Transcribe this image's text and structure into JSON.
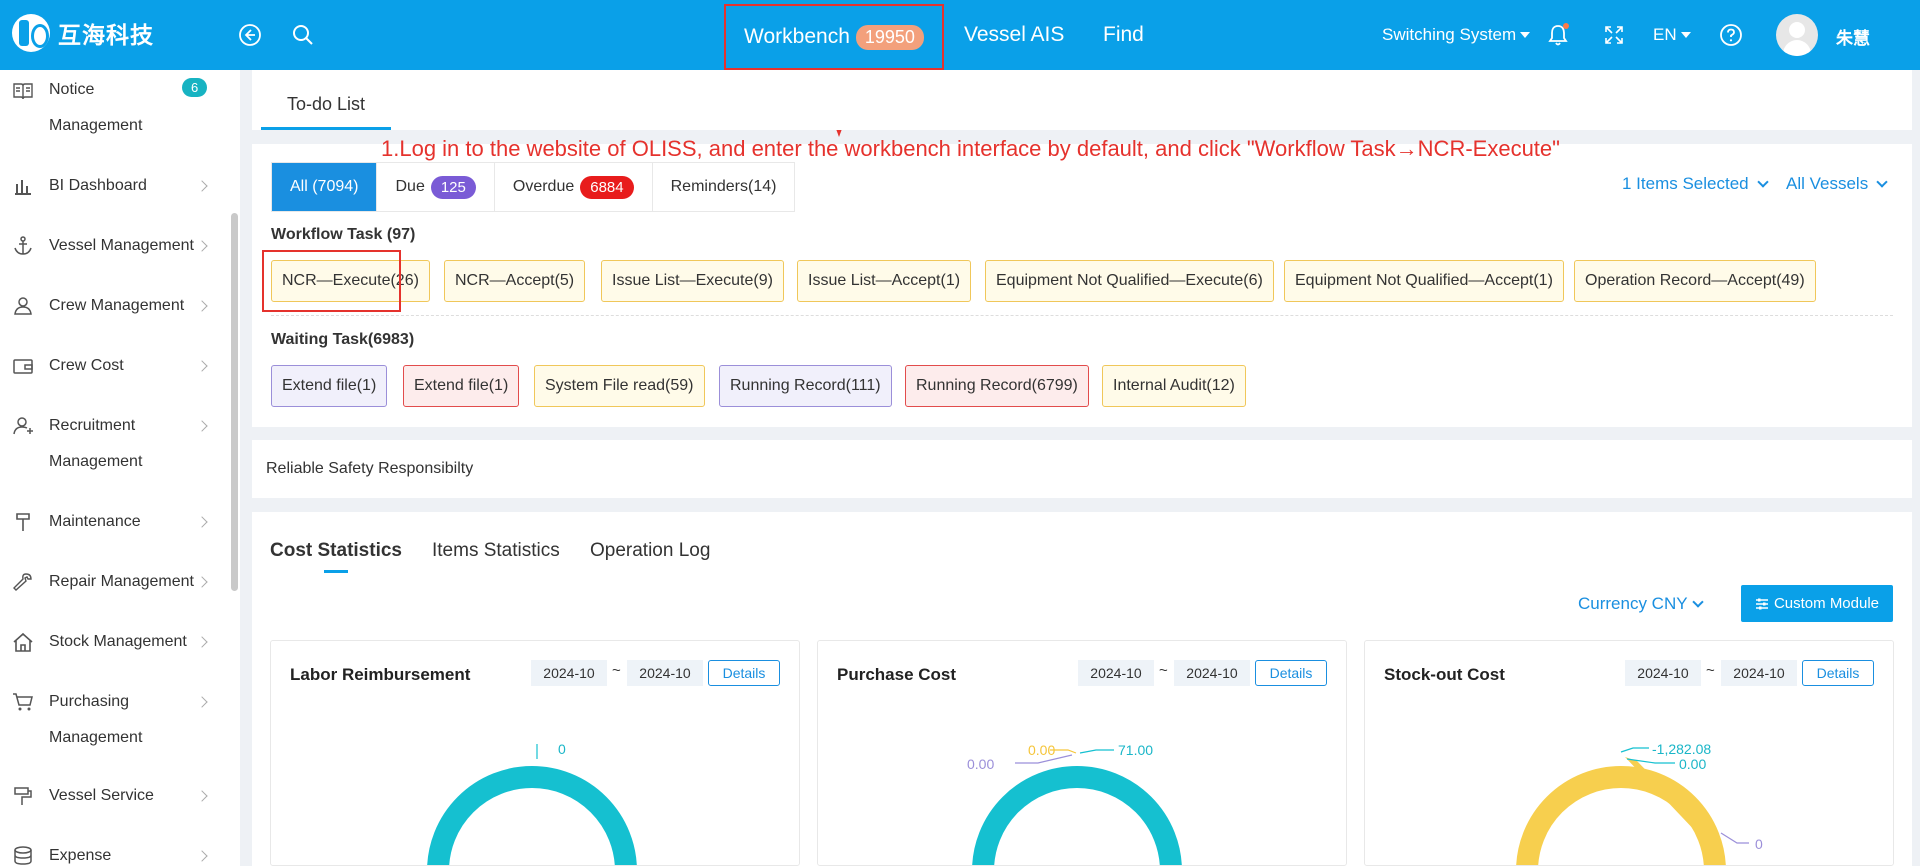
{
  "header": {
    "logo_text": "互海科技",
    "nav": {
      "workbench_label": "Workbench",
      "workbench_count": "19950",
      "vessel_ais": "Vessel AIS",
      "find": "Find"
    },
    "switching_system": "Switching System",
    "language": "EN",
    "user_name": "朱慧",
    "colors": {
      "bar": "#0aa0e8",
      "highlight": "#e5322d"
    }
  },
  "sidebar": {
    "items": [
      {
        "label": "Notice",
        "label2": "Management",
        "badge": "6",
        "icon": "book-icon"
      },
      {
        "label": "BI Dashboard",
        "icon": "bar-chart-icon"
      },
      {
        "label": "Vessel Management",
        "icon": "anchor-icon"
      },
      {
        "label": "Crew Management",
        "icon": "user-icon"
      },
      {
        "label": "Crew Cost",
        "icon": "wallet-icon"
      },
      {
        "label": "Recruitment",
        "label2": "Management",
        "icon": "user-add-icon"
      },
      {
        "label": "Maintenance",
        "icon": "hammer-icon"
      },
      {
        "label": "Repair Management",
        "icon": "wrench-icon"
      },
      {
        "label": "Stock Management",
        "icon": "home-icon"
      },
      {
        "label": "Purchasing",
        "label2": "Management",
        "icon": "cart-icon"
      },
      {
        "label": "Vessel Service",
        "icon": "tool-icon"
      },
      {
        "label": "Expense",
        "icon": "coins-icon"
      }
    ]
  },
  "todo": {
    "tab_label": "To-do List",
    "annotation": "1.Log in to the website of OLISS, and enter the workbench interface by default, and click \"Workflow Task→NCR-Execute\"",
    "filters": {
      "all": "All (7094)",
      "due_label": "Due",
      "due_count": "125",
      "overdue_label": "Overdue",
      "overdue_count": "6884",
      "reminders": "Reminders(14)"
    },
    "items_selected": "1 Items Selected",
    "all_vessels": "All Vessels",
    "workflow_title": "Workflow Task (97)",
    "workflow_tasks": [
      "NCR—Execute(26)",
      "NCR—Accept(5)",
      "Issue List—Execute(9)",
      "Issue List—Accept(1)",
      "Equipment Not Qualified—Execute(6)",
      "Equipment Not Qualified—Accept(1)",
      "Operation Record—Accept(49)"
    ],
    "waiting_title": "Waiting Task(6983)",
    "waiting_tasks": [
      "Extend file(1)",
      "Extend file(1)",
      "System File read(59)",
      "Running Record(111)",
      "Running Record(6799)",
      "Internal Audit(12)"
    ]
  },
  "safety": {
    "label": "Reliable Safety Responsibilty"
  },
  "stats": {
    "tabs": [
      "Cost Statistics",
      "Items Statistics",
      "Operation Log"
    ],
    "currency": "Currency CNY",
    "custom_module": "Custom Module",
    "cards": [
      {
        "title": "Labor Reimbursement",
        "from": "2024-10",
        "to": "2024-10",
        "details": "Details",
        "labels": [
          "0"
        ]
      },
      {
        "title": "Purchase Cost",
        "from": "2024-10",
        "to": "2024-10",
        "details": "Details",
        "labels": [
          "0.00",
          "0.00",
          "71.00"
        ]
      },
      {
        "title": "Stock-out Cost",
        "from": "2024-10",
        "to": "2024-10",
        "details": "Details",
        "labels": [
          "-1,282.08",
          "0.00",
          "0"
        ]
      }
    ]
  }
}
